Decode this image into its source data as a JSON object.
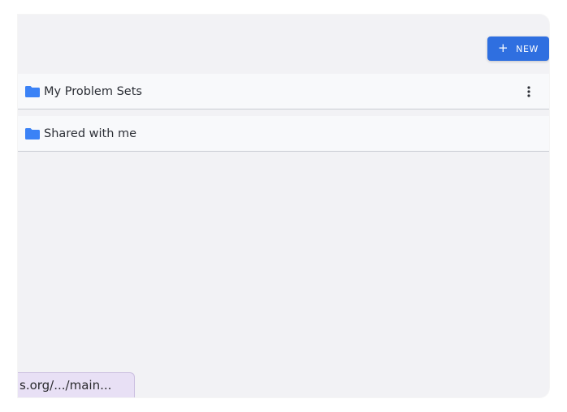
{
  "toolbar": {
    "new_label": "NEW",
    "plus_glyph": "+"
  },
  "folders": [
    {
      "label": "My Problem Sets",
      "has_menu": true
    },
    {
      "label": "Shared with me",
      "has_menu": false
    }
  ],
  "status_bar": {
    "url": "s.org/.../main..."
  },
  "colors": {
    "accent": "#2f6fe0",
    "folder_icon": "#3b82f6",
    "background": "#f2f2f5"
  }
}
